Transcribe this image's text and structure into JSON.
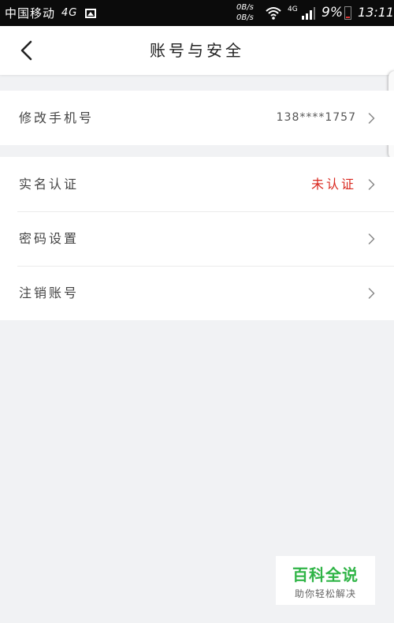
{
  "status_bar": {
    "carrier": "中国移动",
    "network": "4G",
    "speed_up": "0B/s",
    "speed_down": "0B/s",
    "lte_label": "4G",
    "battery": "9%",
    "time": "13:11",
    "icons": [
      "image-icon",
      "wifi-icon",
      "signal-icon",
      "battery-icon"
    ]
  },
  "nav": {
    "back_icon": "chevron-left-icon",
    "title": "账号与安全"
  },
  "groups": [
    {
      "rows": [
        {
          "label": "修改手机号",
          "value": "138****1757",
          "icon": "chevron-right-icon"
        }
      ]
    },
    {
      "rows": [
        {
          "label": "实名认证",
          "value": "未认证",
          "icon": "chevron-right-icon"
        },
        {
          "label": "密码设置",
          "value": "",
          "icon": "chevron-right-icon"
        },
        {
          "label": "注销账号",
          "value": "",
          "icon": "chevron-right-icon"
        }
      ]
    }
  ],
  "colors": {
    "warning": "#d9281f",
    "background": "#f1f2f4",
    "watermark_green": "#2fb446"
  },
  "watermark": {
    "title": "百科全说",
    "subtitle": "助你轻松解决"
  }
}
